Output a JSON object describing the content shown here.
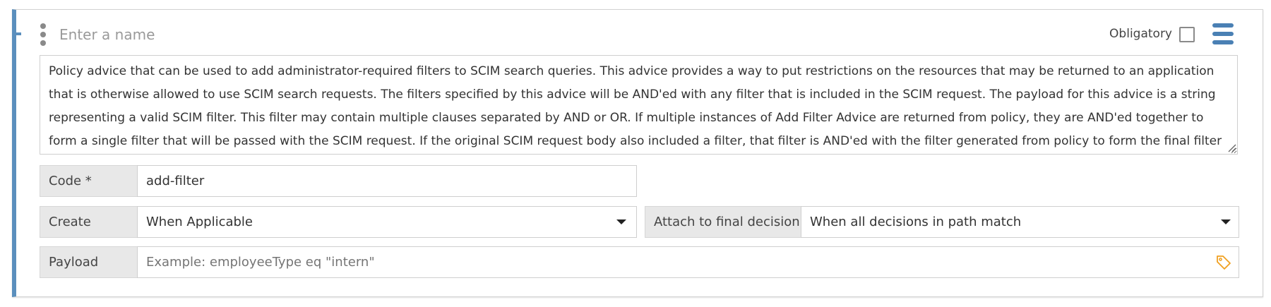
{
  "header": {
    "name_placeholder": "Enter a name",
    "obligatory_label": "Obligatory"
  },
  "description": "Policy advice that can be used to add administrator-required filters to SCIM search queries. This advice provides a way to put restrictions on the resources that may be returned to an application that is otherwise allowed to use SCIM search requests. The filters specified by this advice will be AND'ed with any filter that is included in the SCIM request. The payload for this advice is a string representing a valid SCIM filter. This filter may contain multiple clauses separated by AND or OR. If multiple instances of Add Filter Advice are returned from policy, they are AND'ed together to form a single filter that will be passed with the SCIM request. If the original SCIM request body also included a filter, that filter is AND'ed with the filter generated from policy to form the final filter value.",
  "code": {
    "label": "Code *",
    "value": "add-filter"
  },
  "create": {
    "label": "Create",
    "value": "When Applicable"
  },
  "attach": {
    "label": "Attach to final decision",
    "value": "When all decisions in path match"
  },
  "payload": {
    "label": "Payload",
    "placeholder": "Example: employeeType eq \"intern\""
  },
  "colors": {
    "accent": "#5b8fbd",
    "menu": "#4a80b4",
    "tag_icon": "#f0a020",
    "label_bg": "#e8e8e8"
  },
  "icons": {
    "drag": "kebab-vertical-icon",
    "menu": "hamburger-menu-icon",
    "tag": "tag-icon",
    "select": "caret-down-icon"
  }
}
